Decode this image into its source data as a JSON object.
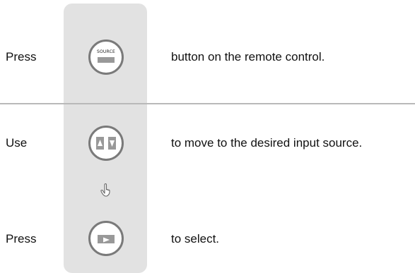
{
  "steps": [
    {
      "verb": "Press",
      "description": "button on the remote control."
    },
    {
      "verb": "Use",
      "description": "to move to the desired input source."
    },
    {
      "verb": "Press",
      "description": "to select."
    }
  ],
  "buttons": {
    "source_label": "SOURCE"
  },
  "icons": {
    "source_button": "source-button-icon",
    "up_down_button": "up-down-arrow-button-icon",
    "hand": "pointing-hand-icon",
    "enter_button": "play-enter-button-icon"
  },
  "colors": {
    "column_background": "#e2e2e2",
    "divider": "#b9b9b9",
    "button_outline": "#7a7a7a",
    "key_fill": "#999999"
  }
}
